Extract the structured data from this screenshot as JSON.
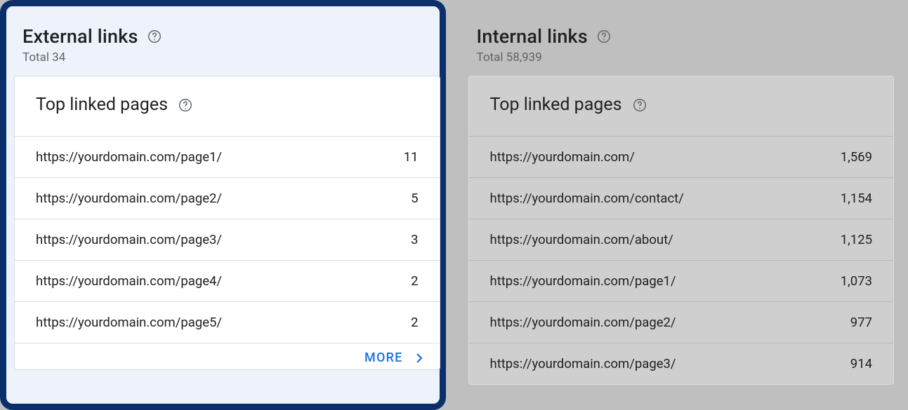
{
  "external": {
    "title": "External links",
    "total_label": "Total 34",
    "section_title": "Top linked pages",
    "rows": [
      {
        "url": "https://yourdomain.com/page1/",
        "count": "11"
      },
      {
        "url": "https://yourdomain.com/page2/",
        "count": "5"
      },
      {
        "url": "https://yourdomain.com/page3/",
        "count": "3"
      },
      {
        "url": "https://yourdomain.com/page4/",
        "count": "2"
      },
      {
        "url": "https://yourdomain.com/page5/",
        "count": "2"
      }
    ],
    "more_label": "MORE"
  },
  "internal": {
    "title": "Internal links",
    "total_label": "Total 58,939",
    "section_title": "Top linked pages",
    "rows": [
      {
        "url": "https://yourdomain.com/",
        "count": "1,569"
      },
      {
        "url": "https://yourdomain.com/contact/",
        "count": "1,154"
      },
      {
        "url": "https://yourdomain.com/about/",
        "count": "1,125"
      },
      {
        "url": "https://yourdomain.com/page1/",
        "count": "1,073"
      },
      {
        "url": "https://yourdomain.com/page2/",
        "count": "977"
      },
      {
        "url": "https://yourdomain.com/page3/",
        "count": "914"
      }
    ]
  }
}
